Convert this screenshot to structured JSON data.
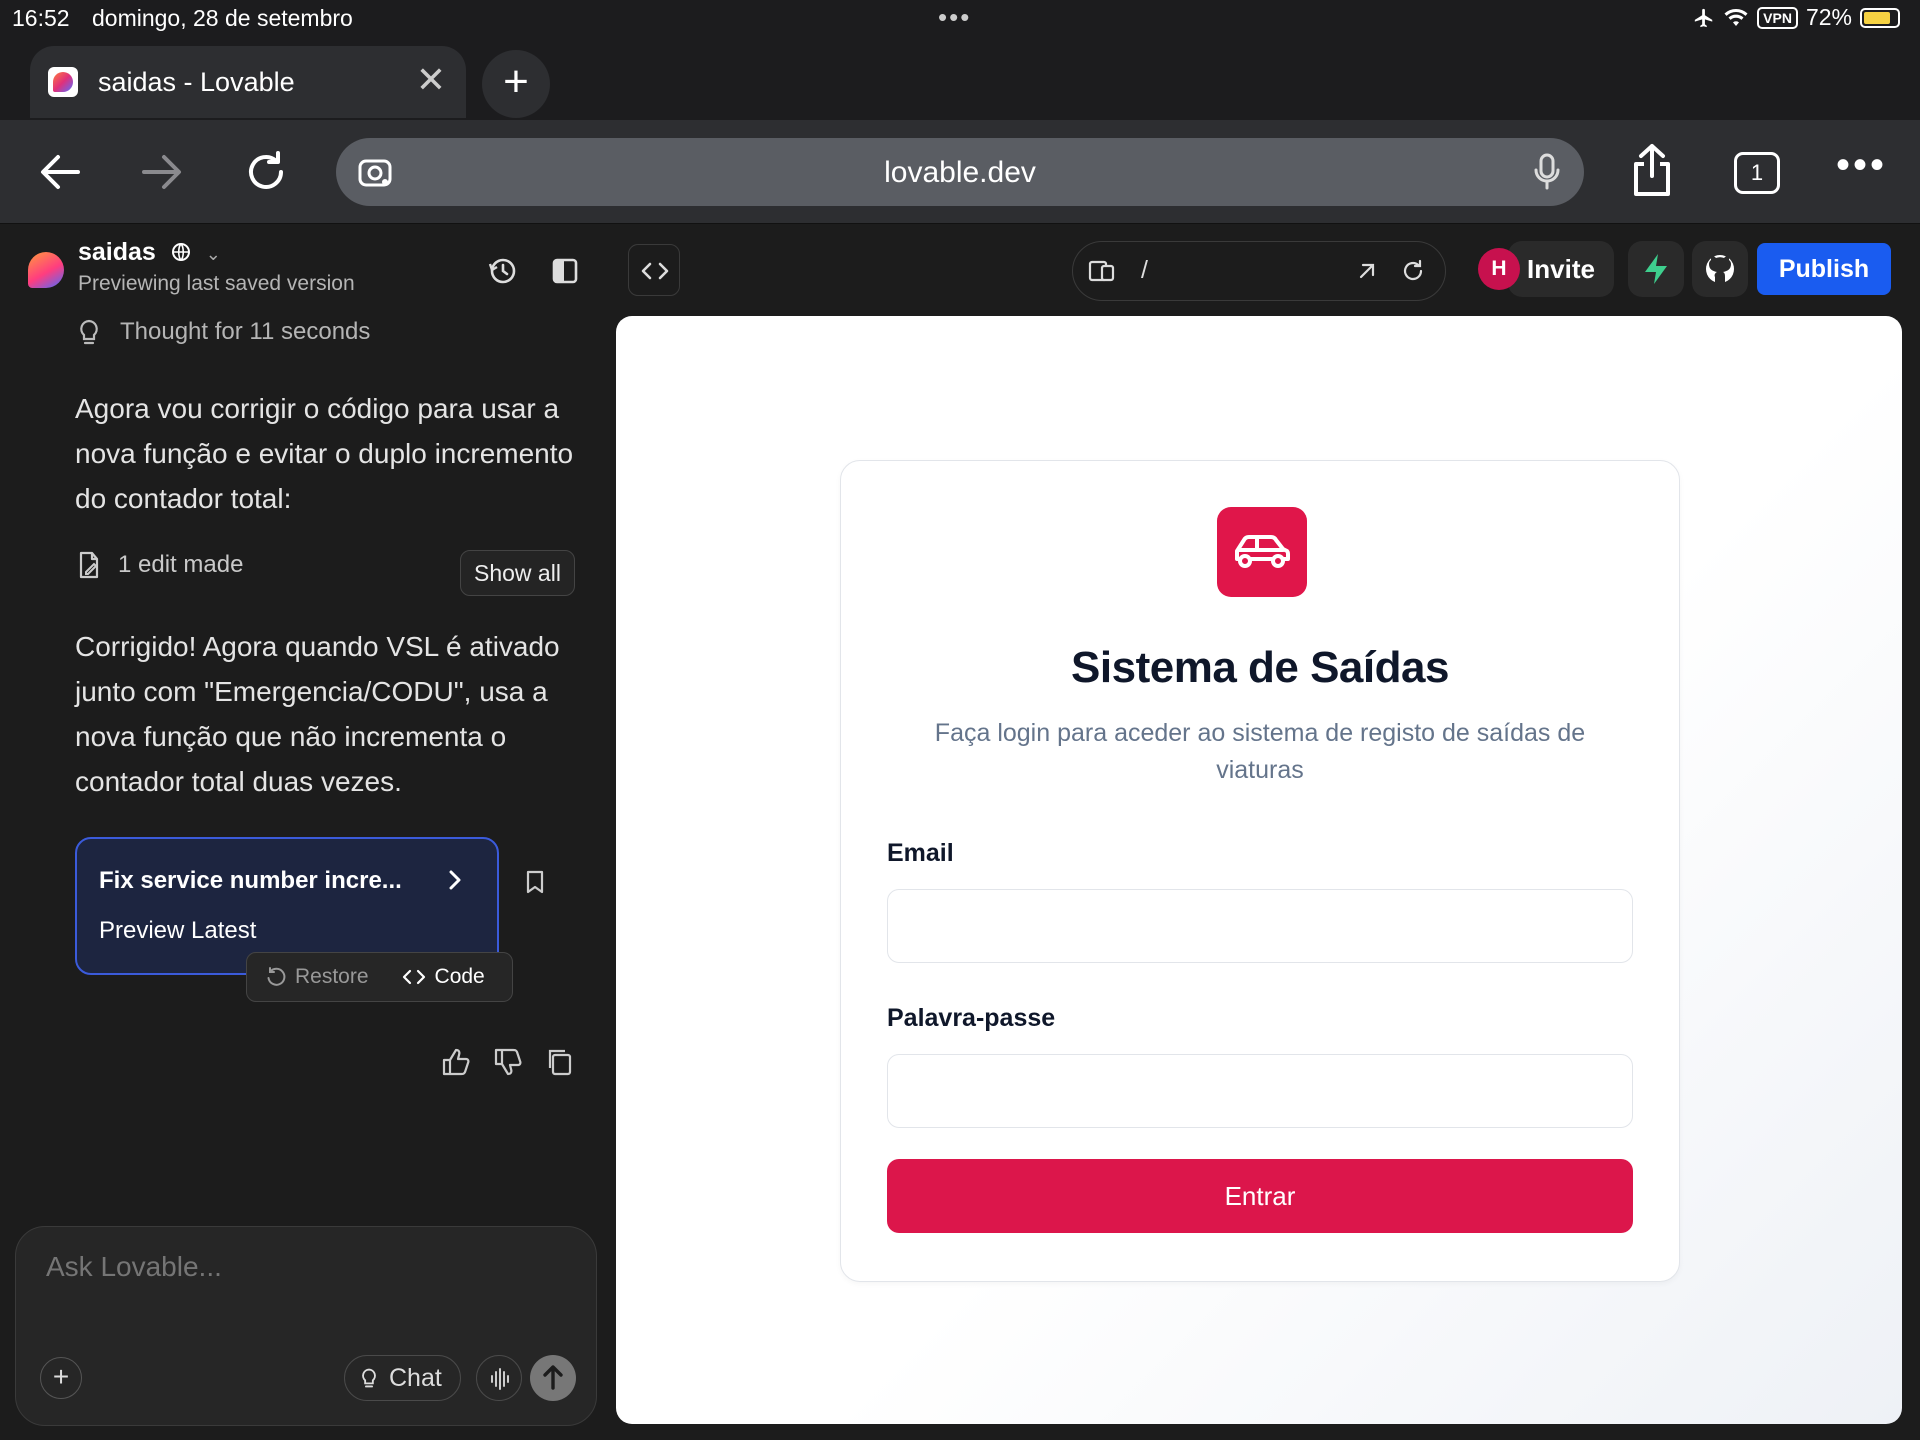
{
  "status_bar": {
    "time": "16:52",
    "date": "domingo, 28 de setembro",
    "vpn": "VPN",
    "battery": "72%"
  },
  "browser": {
    "tab_title": "saidas - Lovable",
    "url": "lovable.dev",
    "tab_count": "1"
  },
  "project": {
    "name": "saidas",
    "subtitle": "Previewing last saved version"
  },
  "chat": {
    "thought": "Thought for 11 seconds",
    "message_1": "Agora vou corrigir o código para usar a nova função e evitar o duplo incremento do contador total:",
    "edits": "1 edit made",
    "show_all": "Show all",
    "message_2": "Corrigido! Agora quando VSL é ativado junto com \"Emergencia/CODU\", usa a nova função que não incrementa o contador total duas vezes.",
    "card_title": "Fix service number incre...",
    "card_subtitle": "Preview Latest",
    "restore": "Restore",
    "code": "Code",
    "input_placeholder": "Ask Lovable...",
    "mode": "Chat"
  },
  "toolbar": {
    "route": "/",
    "avatar": "H",
    "invite": "Invite",
    "publish": "Publish"
  },
  "login": {
    "title": "Sistema de Saídas",
    "subtitle": "Faça login para aceder ao sistema de registo de saídas de viaturas",
    "email_label": "Email",
    "password_label": "Palavra-passe",
    "submit": "Entrar"
  },
  "colors": {
    "brand_red": "#dc164b",
    "publish_blue": "#1a5cf0",
    "card_border": "#3b5bdb",
    "bolt_green": "#3ecf8e"
  }
}
